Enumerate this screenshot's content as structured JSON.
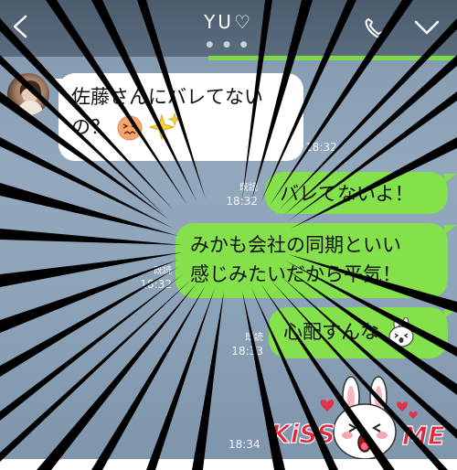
{
  "header": {
    "title": "YU♡",
    "page_dots": "● ● ●",
    "icons": [
      "back-chevron-icon",
      "phone-icon",
      "chevron-down-icon"
    ],
    "bg_color": "#55687a"
  },
  "messages": [
    {
      "side": "left",
      "text_line1": "佐藤さんにバレてない",
      "text_line2": "の？",
      "time": "18:32",
      "emoji": [
        "confounded-face-emoji",
        "sparkles-emoji"
      ]
    },
    {
      "side": "right",
      "text": "バレてないよ！",
      "read": "既読",
      "time": "18:32"
    },
    {
      "side": "right",
      "text_line1": "みかも会社の同期といい",
      "text_line2": "感じみたいだから平気！",
      "read": "既読",
      "time": "18:32"
    },
    {
      "side": "right",
      "text": "心配すんな",
      "read": "既読",
      "time": "18:33",
      "emoji": [
        "cony-bunny-emoji"
      ]
    }
  ],
  "sticker": {
    "name": "kiss-me-sticker",
    "text_left": "KiSS",
    "text_right": "ME"
  },
  "last_time": "18:34",
  "colors": {
    "green_bubble": "#84e04b",
    "white_bubble": "#ffffff",
    "accent_line": "#7cd948"
  }
}
